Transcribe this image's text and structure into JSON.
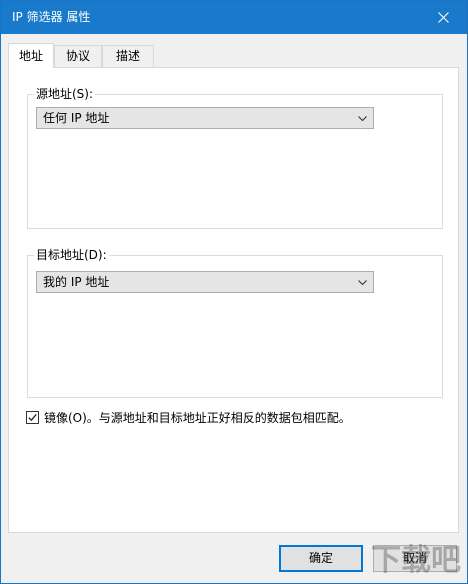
{
  "window": {
    "title": "IP 筛选器 属性"
  },
  "tabs": [
    {
      "label": "地址",
      "active": true
    },
    {
      "label": "协议",
      "active": false
    },
    {
      "label": "描述",
      "active": false
    }
  ],
  "source": {
    "legend": "源地址(S):",
    "selected": "任何 IP 地址"
  },
  "destination": {
    "legend": "目标地址(D):",
    "selected": "我的 IP 地址"
  },
  "mirror": {
    "checked": true,
    "label": "镜像(O)。与源地址和目标地址正好相反的数据包相匹配。"
  },
  "buttons": {
    "ok": "确定",
    "cancel": "取消"
  },
  "watermark": "下载吧",
  "colors": {
    "titlebar": "#1979ca",
    "focus": "#0078d7"
  }
}
